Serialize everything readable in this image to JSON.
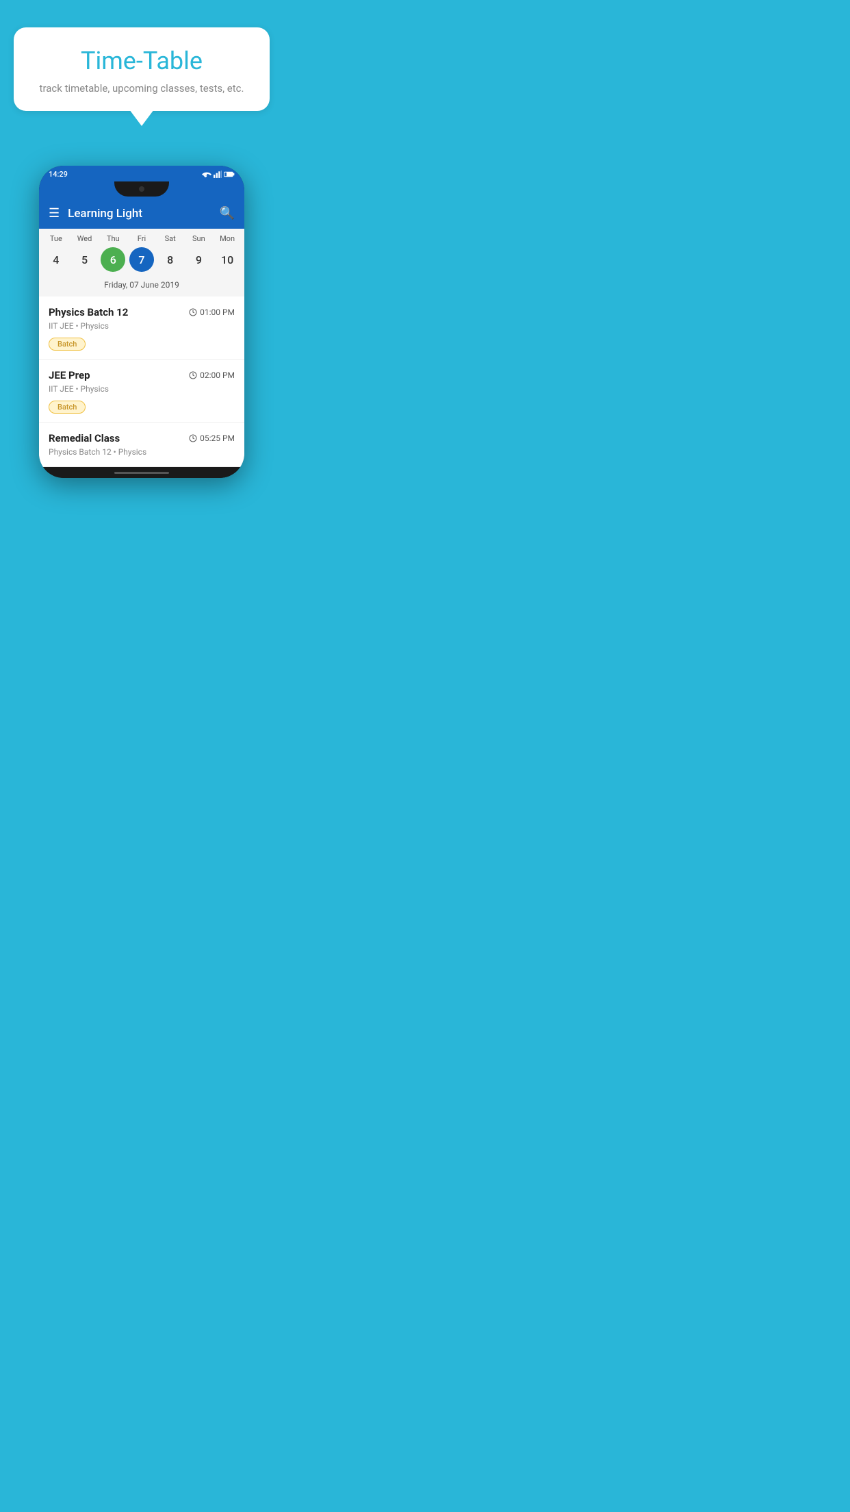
{
  "background": {
    "color": "#29B6D8"
  },
  "speech_bubble": {
    "title": "Time-Table",
    "subtitle": "track timetable, upcoming classes, tests, etc."
  },
  "phone": {
    "status_bar": {
      "time": "14:29"
    },
    "app_header": {
      "title": "Learning Light"
    },
    "calendar": {
      "days": [
        {
          "name": "Tue",
          "num": "4",
          "state": "normal"
        },
        {
          "name": "Wed",
          "num": "5",
          "state": "normal"
        },
        {
          "name": "Thu",
          "num": "6",
          "state": "today"
        },
        {
          "name": "Fri",
          "num": "7",
          "state": "selected"
        },
        {
          "name": "Sat",
          "num": "8",
          "state": "normal"
        },
        {
          "name": "Sun",
          "num": "9",
          "state": "normal"
        },
        {
          "name": "Mon",
          "num": "10",
          "state": "normal"
        }
      ],
      "selected_date_label": "Friday, 07 June 2019"
    },
    "schedule_items": [
      {
        "title": "Physics Batch 12",
        "time": "01:00 PM",
        "meta": "IIT JEE • Physics",
        "badge": "Batch"
      },
      {
        "title": "JEE Prep",
        "time": "02:00 PM",
        "meta": "IIT JEE • Physics",
        "badge": "Batch"
      },
      {
        "title": "Remedial Class",
        "time": "05:25 PM",
        "meta": "Physics Batch 12 • Physics",
        "badge": null
      }
    ]
  }
}
